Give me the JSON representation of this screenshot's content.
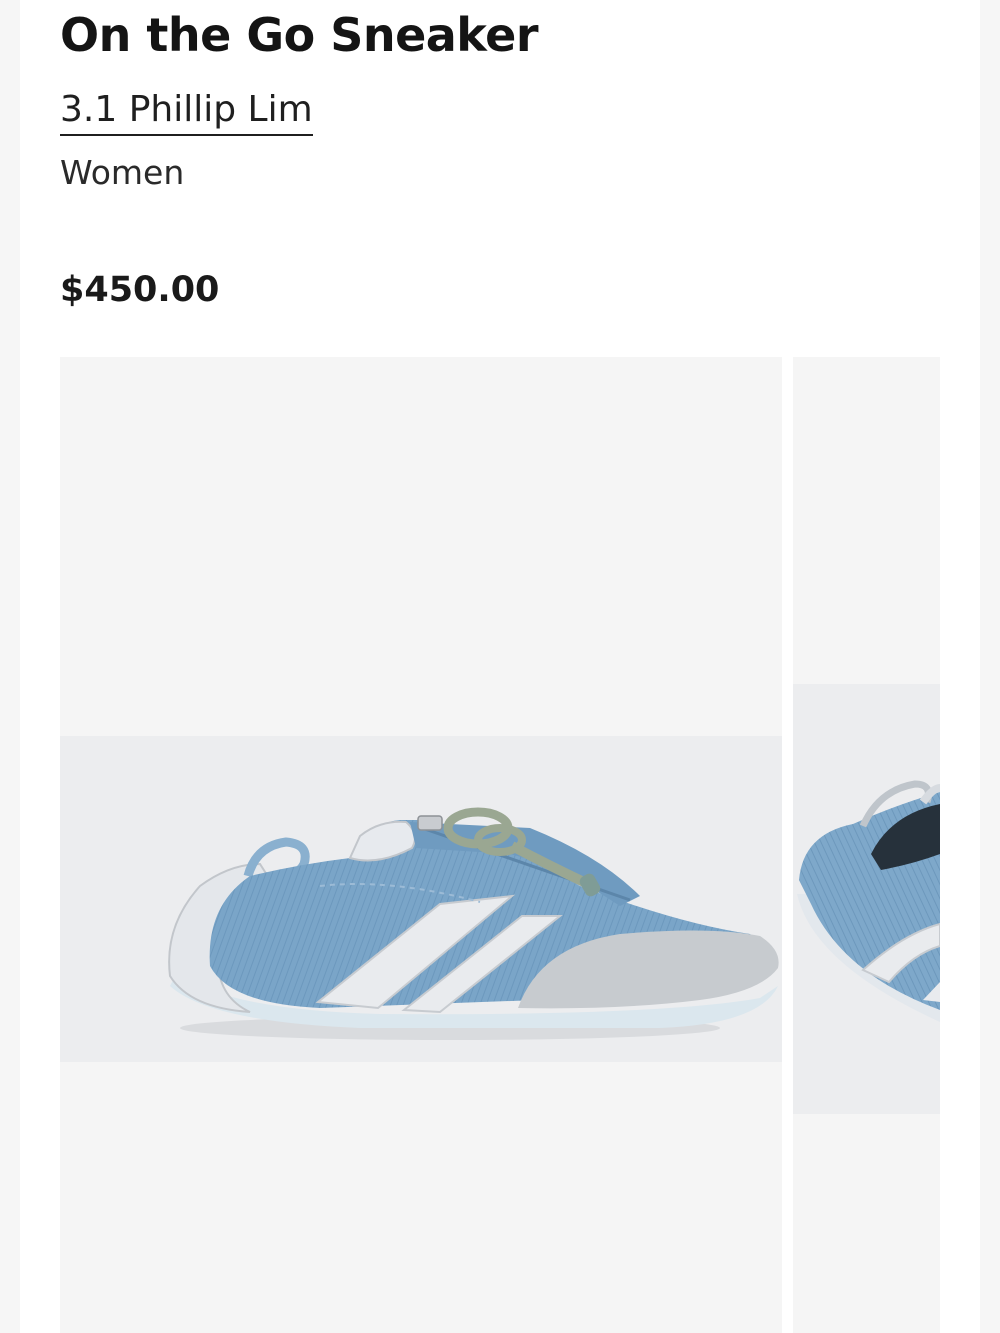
{
  "product": {
    "title": "On the Go Sneaker",
    "brand": "3.1 Phillip Lim",
    "category": "Women",
    "price": "$450.00"
  },
  "gallery": {
    "images": [
      {
        "icon": "sneaker-side-view-image"
      },
      {
        "icon": "sneaker-angle-view-image"
      }
    ]
  },
  "colors": {
    "denim": "#7aa5c8",
    "suede": "#c7cbcf",
    "leather": "#e7eaee",
    "lace": "#9aa792"
  }
}
